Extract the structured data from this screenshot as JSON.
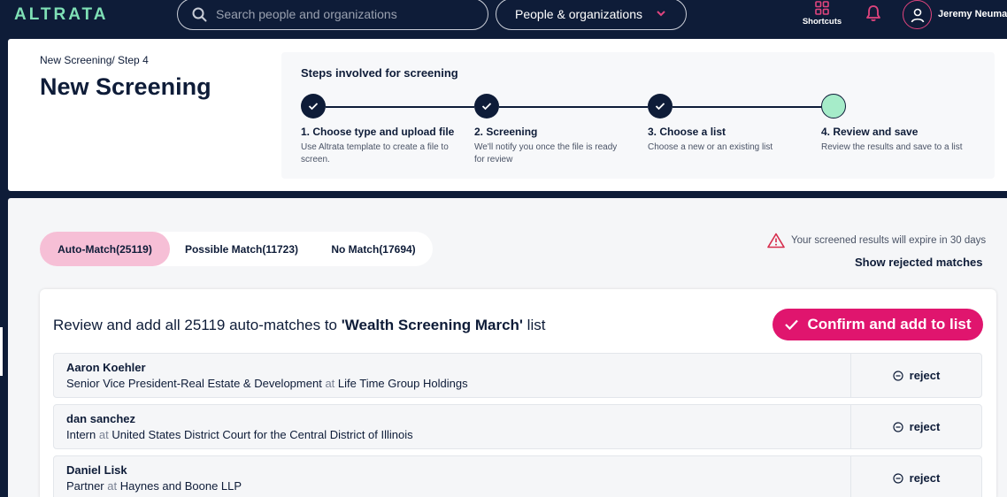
{
  "app": {
    "logo": "ALTRATA",
    "search_placeholder": "Search people and organizations",
    "scope_selector": "People & organizations",
    "shortcuts_label": "Shortcuts",
    "username": "Jeremy Neuma"
  },
  "header": {
    "breadcrumb": "New Screening/ Step 4",
    "title": "New Screening",
    "steps_title": "Steps involved for screening",
    "steps": [
      {
        "label": "1. Choose type and upload file",
        "desc": "Use Altrata template to create a file to screen.",
        "status": "done"
      },
      {
        "label": "2. Screening",
        "desc": "We'll notify you once the file is ready for review",
        "status": "done"
      },
      {
        "label": "3. Choose a list",
        "desc": "Choose a new or an existing list",
        "status": "done"
      },
      {
        "label": "4. Review and save",
        "desc": "Review the results and save to a list",
        "status": "current"
      }
    ]
  },
  "tabs": [
    {
      "label": "Auto-Match",
      "count": "(25119)",
      "active": true
    },
    {
      "label": "Possible Match",
      "count": "(11723)",
      "active": false
    },
    {
      "label": "No Match",
      "count": "(17694)",
      "active": false
    }
  ],
  "expire_notice": "Your screened results will expire in 30 days",
  "show_rejected_label": "Show rejected matches",
  "review": {
    "prefix": "Review and add all 25119 auto-matches to ",
    "list_name": "'Wealth Screening March'",
    "suffix": " list",
    "confirm_label": "Confirm and add to list"
  },
  "results": [
    {
      "name": "Aaron Koehler",
      "role": "Senior Vice President-Real Estate & Development",
      "at": "at",
      "org": "Life Time Group Holdings",
      "reject_label": "reject"
    },
    {
      "name": "dan sanchez",
      "role": "Intern",
      "at": "at",
      "org": "United States District Court for the Central District of Illinois",
      "reject_label": "reject"
    },
    {
      "name": "Daniel Lisk",
      "role": "Partner",
      "at": "at",
      "org": "Haynes and Boone LLP",
      "reject_label": "reject"
    }
  ],
  "colors": {
    "navy": "#0e1c38",
    "mint": "#7fe0b6",
    "pink_accent": "#e0156e",
    "tab_active": "#f6bfd6",
    "step_current": "#a6ecc9"
  }
}
